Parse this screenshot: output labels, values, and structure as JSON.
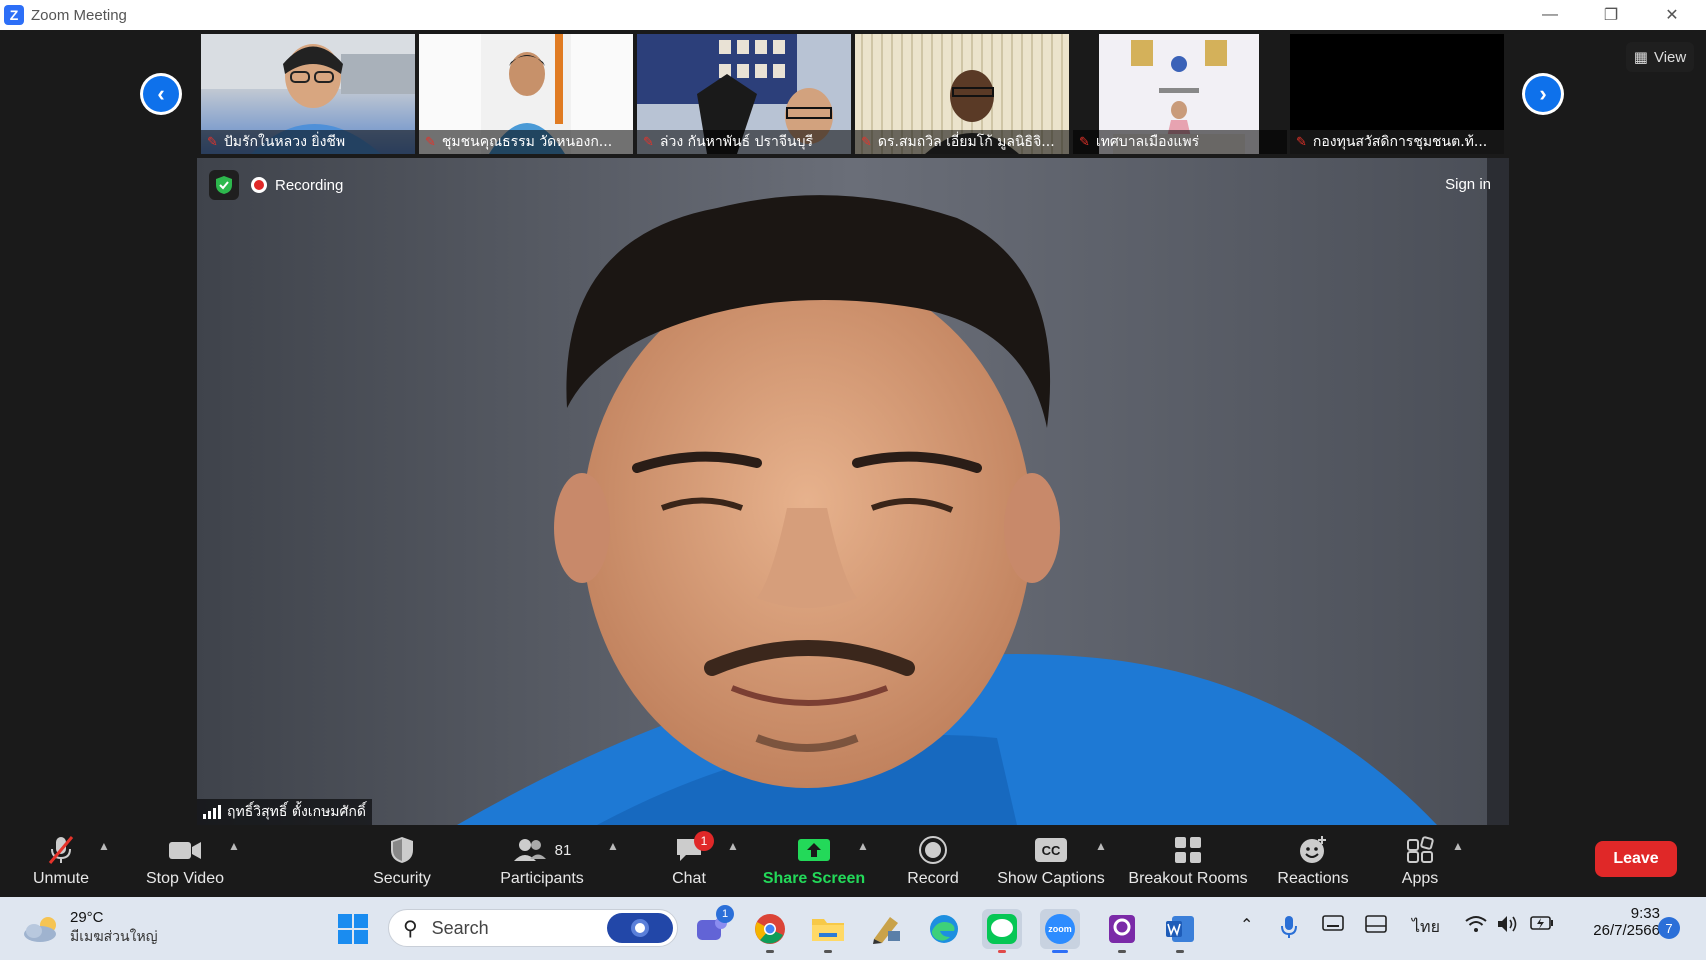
{
  "window": {
    "title": "Zoom Meeting",
    "app_logo": "Z"
  },
  "gallery": {
    "participants": [
      {
        "name": "ปัมรักในหลวง ยิ่งชีพ"
      },
      {
        "name": "ชุมชนคุณธรรม วัดหนองก..."
      },
      {
        "name": "ล่วง กันหาพันธ์ ปราจีนบุรี"
      },
      {
        "name": "ดร.สมถวิล เอี่ยมโก้ มูลนิธิจิ..."
      },
      {
        "name": "เทศบาลเมืองแพร่"
      },
      {
        "name": "กองทุนสวัสดิการชุมชนต.ท้..."
      }
    ],
    "view_label": "View"
  },
  "main": {
    "recording_label": "Recording",
    "sign_in_label": "Sign in",
    "speaker_name": "ฤทธิ์วิสุทธิ์ ตั้งเกษมศักดิ์"
  },
  "toolbar": {
    "unmute": "Unmute",
    "stop_video": "Stop Video",
    "security": "Security",
    "participants": "Participants",
    "participants_count": "81",
    "chat": "Chat",
    "chat_badge": "1",
    "share_screen": "Share Screen",
    "record": "Record",
    "show_captions": "Show Captions",
    "captions_icon_text": "CC",
    "breakout_rooms": "Breakout Rooms",
    "reactions": "Reactions",
    "apps": "Apps",
    "leave": "Leave"
  },
  "taskbar": {
    "weather_temp": "29°C",
    "weather_desc": "มีเมฆส่วนใหญ่",
    "search_placeholder": "Search",
    "teams_badge": "1",
    "language": "ไทย",
    "time": "9:33",
    "date": "26/7/2566",
    "notification_count": "7",
    "zoom_icon_text": "zoom"
  },
  "colors": {
    "accent_blue": "#0e71eb",
    "share_green": "#23d959",
    "leave_red": "#e02828",
    "mute_red": "#e5332a"
  }
}
